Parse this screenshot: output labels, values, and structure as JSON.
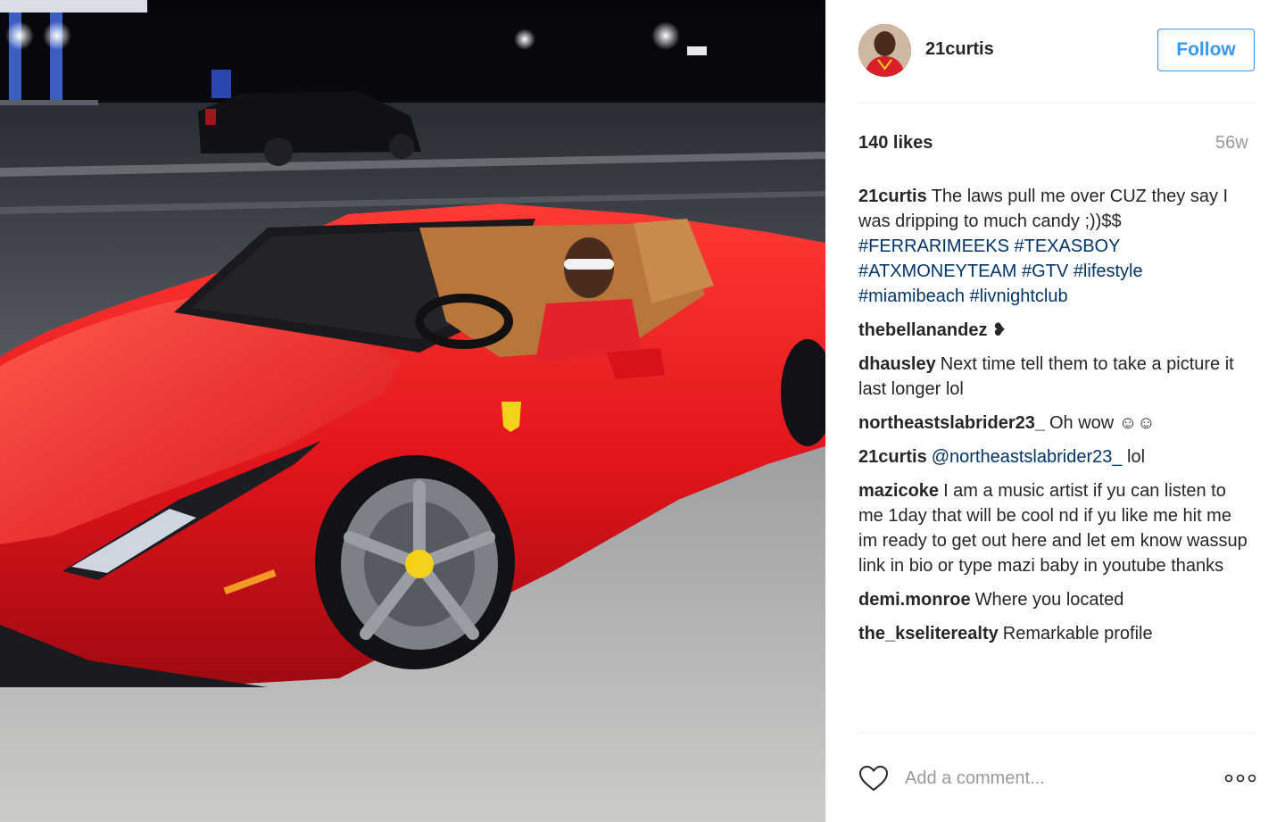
{
  "post": {
    "username": "21curtis",
    "follow_label": "Follow",
    "likes": "140 likes",
    "age": "56w"
  },
  "icons": {
    "avatar": "avatar-image",
    "like": "heart-icon",
    "more": "more-options-icon"
  },
  "caption": {
    "author": "21curtis",
    "text": "The laws pull me over CUZ they say I was dripping to much candy ;))$$",
    "hashtags": [
      "#FERRARIMEEKS",
      "#TEXASBOY",
      "#ATXMONEYTEAM",
      "#GTV",
      "#lifestyle",
      "#miamibeach",
      "#livnightclub"
    ]
  },
  "comments": [
    {
      "author": "thebellanandez",
      "text": "",
      "emoji": "black-heart-emoji"
    },
    {
      "author": "dhausley",
      "text": "Next time tell them to take a picture it last longer lol"
    },
    {
      "author": "northeastslabrider23_",
      "text": "Oh wow",
      "emoji": "laughing-emoji"
    },
    {
      "author": "21curtis",
      "mention": "@northeastslabrider23_",
      "text": "lol"
    },
    {
      "author": "mazicoke",
      "text": "I am a music artist if yu can listen to me 1day that will be cool nd if yu like me hit me im ready to get out here and let em know wassup link in bio or type mazi baby in youtube thanks"
    },
    {
      "author": "demi.monroe",
      "text": "Where you located"
    },
    {
      "author": "the_kselitere​alty",
      "text": "Remarkable profile"
    }
  ],
  "add_comment": {
    "placeholder": "Add a comment..."
  },
  "colors": {
    "link": "#003569",
    "accent": "#3897f0",
    "car": "#e0141b"
  }
}
